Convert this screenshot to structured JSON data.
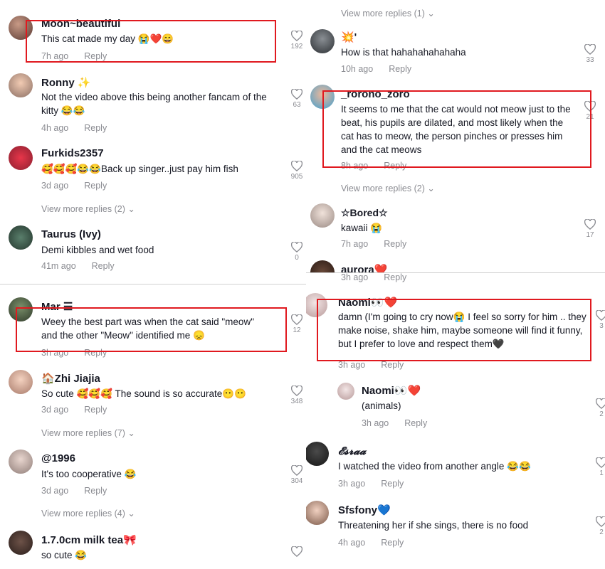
{
  "left": {
    "comments": [
      {
        "user": "Moon~beautiful",
        "text": "This cat made my day 😭❤️😄",
        "time": "7h ago",
        "reply": "Reply",
        "likes": "192"
      },
      {
        "user": "Ronny ✨",
        "text": "Not the video above this being another fancam of the kitty 😂😂",
        "time": "4h ago",
        "reply": "Reply",
        "likes": "63"
      },
      {
        "user": "Furkids2357",
        "text": "🥰🥰🥰😂😂Back up singer..just pay him fish",
        "time": "3d ago",
        "reply": "Reply",
        "likes": "905",
        "view_more": "View more replies (2)"
      },
      {
        "user": "Taurus (Ivy)",
        "text": "Demi kibbles and wet food",
        "time": "41m ago",
        "reply": "Reply",
        "likes": "0"
      },
      {
        "user": "Mar ☰",
        "text": "Weey the best part was when the cat said \"meow\" and the other \"Meow\" identified me 😞",
        "time": "3h ago",
        "reply": "Reply",
        "likes": "12"
      },
      {
        "user": "🏠Zhi Jiajia",
        "text": "So cute 🥰🥰🥰 The sound is so accurate😶😶",
        "time": "3d ago",
        "reply": "Reply",
        "likes": "348",
        "view_more": "View more replies (7)"
      },
      {
        "user": "@1996",
        "text": "It's too cooperative 😂",
        "time": "3d ago",
        "reply": "Reply",
        "likes": "304",
        "view_more": "View more replies (4)"
      },
      {
        "user": "1.7.0cm milk tea🎀",
        "text": "so cute 😂",
        "time": "",
        "reply": "",
        "likes": ""
      }
    ]
  },
  "right": {
    "top_view_more": "View more replies (1)",
    "comments": [
      {
        "user": "💥'",
        "text": "How is that hahahahahahaha",
        "time": "10h ago",
        "reply": "Reply",
        "likes": "33"
      },
      {
        "user": "_rorono_zoro",
        "text": "It seems to me that the cat would not meow just to the beat, his pupils are dilated, and most likely when the cat has to meow, the person pinches or presses him and the cat meows",
        "time": "8h ago",
        "reply": "Reply",
        "likes": "21",
        "view_more": "View more replies (2)"
      },
      {
        "user": "☆Bored☆",
        "text": "kawaii 😭",
        "time": "7h ago",
        "reply": "Reply",
        "likes": "17"
      },
      {
        "user": "aurora❤️",
        "text": "",
        "time": "3h ago",
        "reply": "Reply",
        "likes": ""
      },
      {
        "user": "Naomi👀❤️",
        "text": "damn (I'm going to cry now😭 I feel so sorry for him .. they make noise, shake him, maybe someone will find it funny, but I prefer to love and respect them🖤",
        "time": "3h ago",
        "reply": "Reply",
        "likes": "3"
      },
      {
        "user": "Naomi👀❤️",
        "text": "(animals)",
        "time": "3h ago",
        "reply": "Reply",
        "likes": "2"
      },
      {
        "user": "𝓔𝓼𝓻𝓪𝓪",
        "text": "I watched the video from another angle 😂😂",
        "time": "3h ago",
        "reply": "Reply",
        "likes": "1"
      },
      {
        "user": "Sfsfony💙",
        "text": "Threatening her if she sings, there is no food",
        "time": "4h ago",
        "reply": "Reply",
        "likes": "2"
      }
    ]
  },
  "colors": {
    "highlight_box": "#e0191f",
    "muted": "#8a8b91",
    "text": "#161823"
  }
}
